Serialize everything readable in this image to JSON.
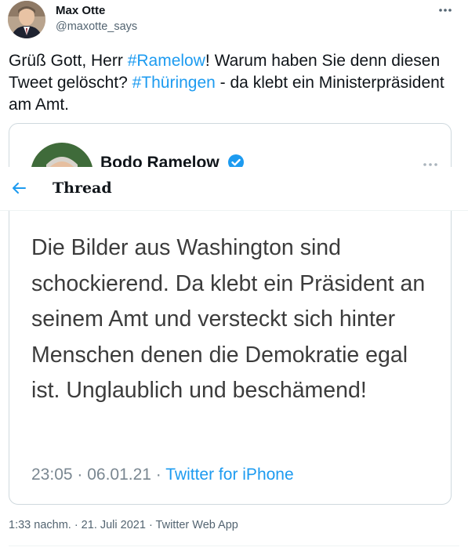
{
  "tweet": {
    "author_name": "Max Otte",
    "author_handle": "@maxotte_says",
    "text_parts": {
      "p1": "Grüß Gott, Herr ",
      "hashtag1": "#Ramelow",
      "p2": "! Warum haben Sie denn diesen Tweet gelöscht? ",
      "hashtag2": "#Thüringen",
      "p3": " - da klebt ein Ministerpräsident am Amt."
    },
    "timestamp": "1:33 nachm. · 21. Juli 2021",
    "separator": " · ",
    "client": "Twitter Web App"
  },
  "quote": {
    "author_name": "Bodo Ramelow",
    "body": "Die Bilder aus Washington sind schockierend. Da klebt ein Präsident an seinem Amt und versteckt sich hinter Menschen denen die Demokratie egal ist. Unglaublich und beschämend!",
    "datetime": "23:05 · 06.01.21 · ",
    "source": "Twitter for iPhone"
  },
  "thread_bar": {
    "title": "Thread"
  },
  "icons": {
    "more": "more-horizontal-icon",
    "verified": "verified-badge-icon",
    "back": "arrow-left-icon"
  },
  "colors": {
    "accent": "#1d9bf0",
    "text": "#0f1419",
    "secondary": "#536471",
    "border": "#cfd9de"
  }
}
